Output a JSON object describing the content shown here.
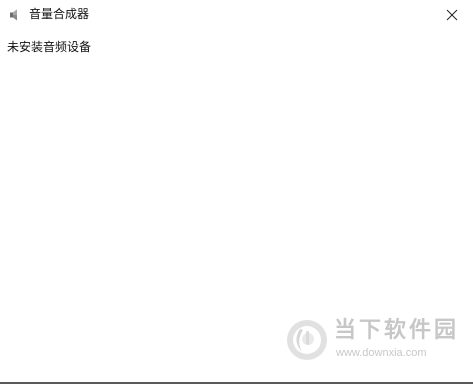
{
  "window": {
    "title": "音量合成器",
    "title_icon": "speaker-icon",
    "close_icon": "close-icon"
  },
  "content": {
    "status_message": "未安装音频设备"
  },
  "watermark": {
    "brand_text": "当下软件园",
    "url": "www.downxia.com",
    "logo_icon": "downxia-logo-icon"
  }
}
